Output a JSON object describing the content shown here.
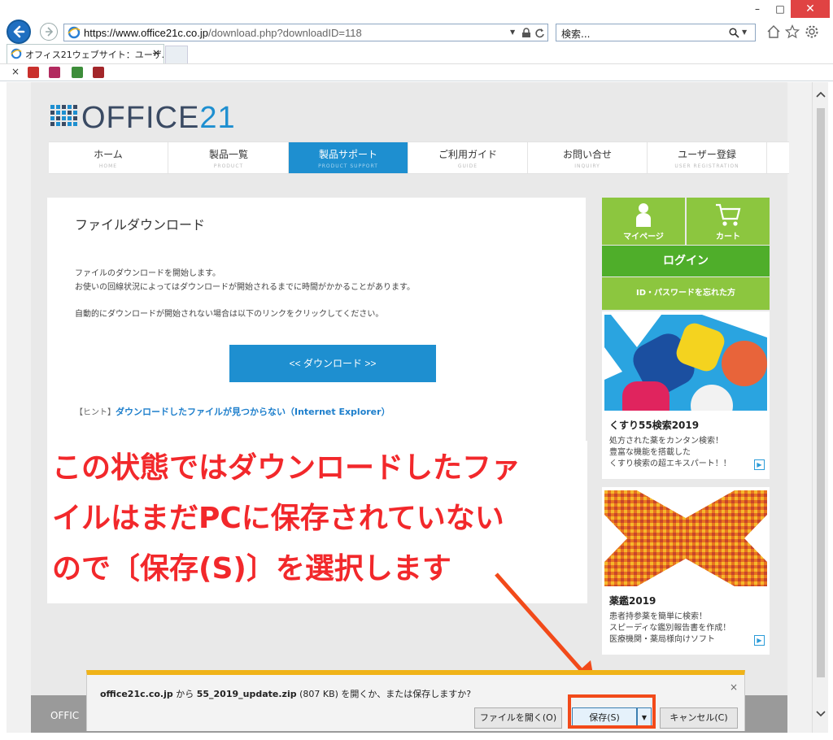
{
  "browser": {
    "window_buttons": {
      "minimize": "–",
      "maximize": "□",
      "close": "✕"
    },
    "address": {
      "host": "https://www.office21c.co.jp",
      "path": "/download.php?downloadID=118"
    },
    "search_placeholder": "検索...",
    "tab_label": "オフィス21ウェブサイト：ユーザ...",
    "tab_close": "×",
    "favbar_close": "×"
  },
  "site": {
    "logo": {
      "word": "OFFICE",
      "number": "21"
    },
    "nav": [
      {
        "jp": "ホーム",
        "en": "HOME"
      },
      {
        "jp": "製品一覧",
        "en": "PRODUCT"
      },
      {
        "jp": "製品サポート",
        "en": "PRODUCT SUPPORT"
      },
      {
        "jp": "ご利用ガイド",
        "en": "GUIDE"
      },
      {
        "jp": "お問い合せ",
        "en": "INQUIRY"
      },
      {
        "jp": "ユーザー登録",
        "en": "USER REGISTRATION"
      }
    ],
    "main": {
      "title": "ファイルダウンロード",
      "line1": "ファイルのダウンロードを開始します。",
      "line2": "お使いの回線状況によってはダウンロードが開始されるまでに時間がかかることがあります。",
      "line3": "自動的にダウンロードが開始されない場合は以下のリンクをクリックしてください。",
      "download_button": "<< ダウンロード >>",
      "hint_prefix": "【ヒント】",
      "hint_link": "ダウンロードしたファイルが見つからない（Internet Explorer）"
    },
    "sidebar": {
      "mypage": "マイページ",
      "cart": "カート",
      "login": "ログイン",
      "forgot": "ID・パスワードを忘れた方",
      "promo1": {
        "title": "くすり55検索2019",
        "lines": [
          "処方された薬をカンタン検索！",
          "豊富な機能を搭載した",
          "くすり検索の超エキスパート！！"
        ]
      },
      "promo2": {
        "title": "薬鑑2019",
        "lines": [
          "患者持参薬を簡単に検索！",
          "スピーディな鑑別報告書を作成！",
          "医療機関・薬局様向けソフト"
        ]
      }
    },
    "footer_text": "OFFIC"
  },
  "annotation": {
    "lines": [
      "この状態ではダウンロードしたファ",
      "イルはまだPCに保存されていない",
      "ので〔保存(S)〕を選択します"
    ]
  },
  "download_bar": {
    "host": "office21c.co.jp",
    "from": " から ",
    "filename": "55_2019_update.zip",
    "size": " (807 KB)",
    "question": " を開くか、または保存しますか?",
    "close": "×",
    "open_button": "ファイルを開く(O)",
    "save_button": "保存(S)",
    "save_arrow": "▼",
    "cancel_button": "キャンセル(C)"
  },
  "colors": {
    "accent": "#1e8fd0",
    "green": "#8cc63f",
    "login_green": "#4fae2a",
    "annotation_red": "#f2282b",
    "notification_bar": "#f0b319"
  }
}
